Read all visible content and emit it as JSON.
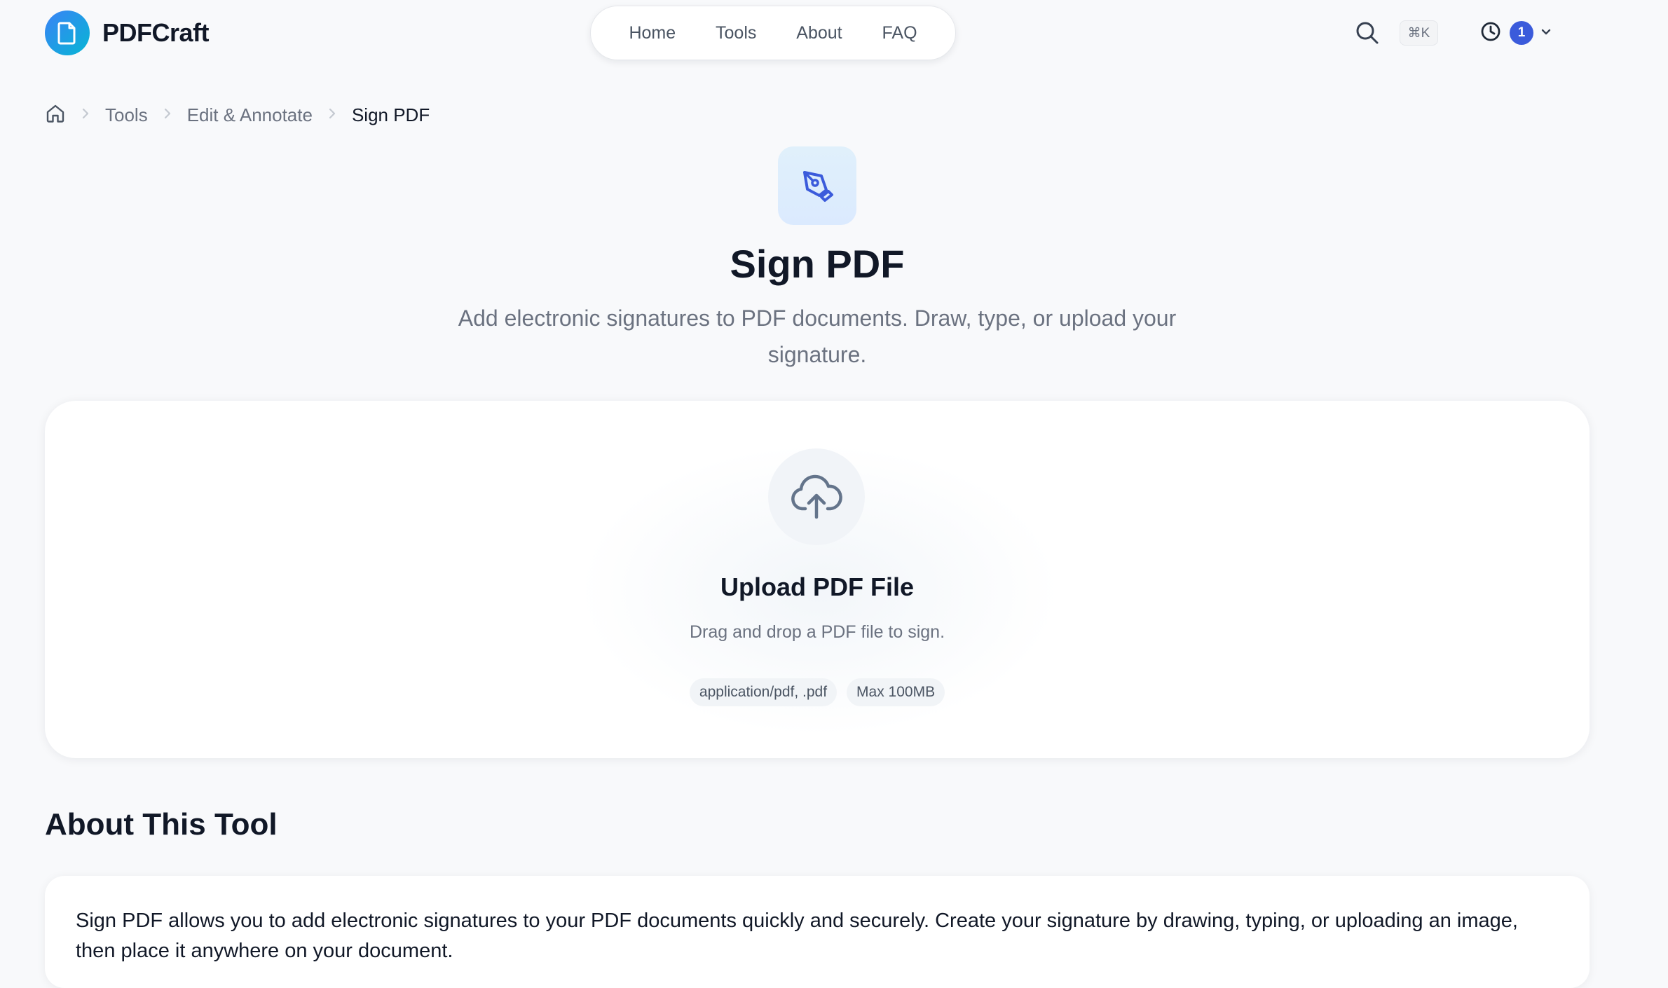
{
  "brand": {
    "name": "PDFCraft",
    "accent": "#3b82f6"
  },
  "nav": {
    "items": [
      "Home",
      "Tools",
      "About",
      "FAQ"
    ]
  },
  "header": {
    "shortcut": "⌘K",
    "history_count": "1"
  },
  "breadcrumb": {
    "items": [
      "Tools",
      "Edit & Annotate"
    ],
    "current": "Sign PDF"
  },
  "hero": {
    "title": "Sign PDF",
    "subtitle": "Add electronic signatures to PDF documents. Draw, type, or upload your signature."
  },
  "upload": {
    "title": "Upload PDF File",
    "description": "Drag and drop a PDF file to sign.",
    "chips": [
      "application/pdf, .pdf",
      "Max 100MB"
    ]
  },
  "about": {
    "heading": "About This Tool",
    "text": "Sign PDF allows you to add electronic signatures to your PDF documents quickly and securely. Create your signature by drawing, typing, or uploading an image, then place it anywhere on your document."
  },
  "icons": {
    "logo": "document-icon",
    "search": "search-icon",
    "history": "clock-icon",
    "tool": "pen-tool-icon",
    "upload": "cloud-upload-icon",
    "home": "home-icon"
  }
}
